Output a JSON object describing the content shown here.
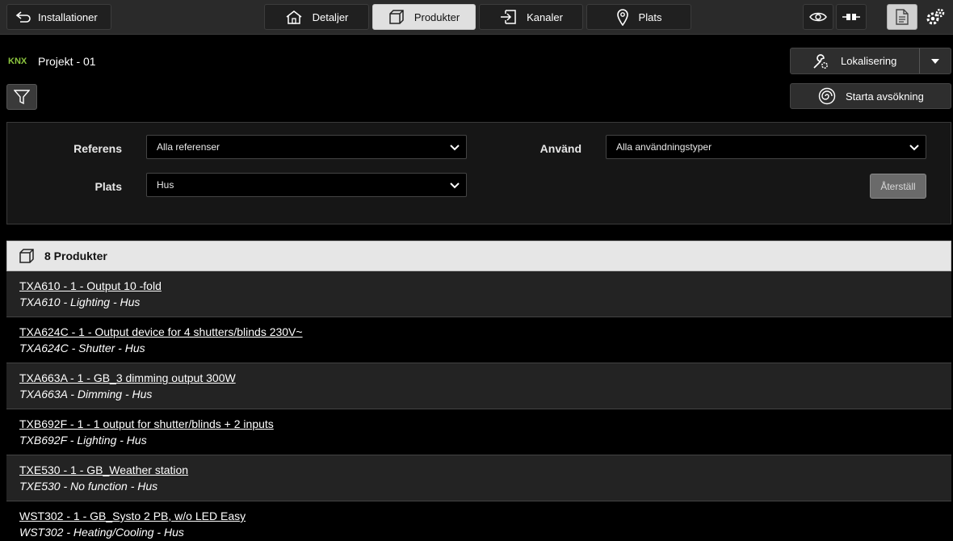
{
  "toolbar": {
    "back_label": "Installationer",
    "tabs": [
      {
        "label": "Detaljer",
        "icon": "home-icon"
      },
      {
        "label": "Produkter",
        "icon": "cube-icon"
      },
      {
        "label": "Kanaler",
        "icon": "channel-icon"
      },
      {
        "label": "Plats",
        "icon": "location-pin-icon"
      }
    ],
    "active_tab": "Produkter",
    "right_icons": [
      "eye-icon",
      "connector-icon",
      "document-icon",
      "gears-icon"
    ]
  },
  "header": {
    "logo_text": "KNX",
    "project_title": "Projekt - 01",
    "localization_label": "Lokalisering",
    "scan_label": "Starta avsökning"
  },
  "filters": {
    "reference_label": "Referens",
    "reference_value": "Alla referenser",
    "use_label": "Använd",
    "use_value": "Alla användningstyper",
    "location_label": "Plats",
    "location_value": "Hus",
    "reset_label": "Återställ"
  },
  "products": {
    "header": "8 Produkter",
    "items": [
      {
        "title": "TXA610 - 1 - Output 10 -fold",
        "subtitle": "TXA610 - Lighting - Hus"
      },
      {
        "title": "TXA624C - 1 - Output device for 4 shutters/blinds 230V~",
        "subtitle": "TXA624C - Shutter - Hus"
      },
      {
        "title": "TXA663A - 1 - GB_3 dimming output 300W",
        "subtitle": "TXA663A - Dimming - Hus"
      },
      {
        "title": "TXB692F - 1 - 1 output for shutter/blinds + 2 inputs",
        "subtitle": "TXB692F - Lighting - Hus"
      },
      {
        "title": "TXE530 - 1 - GB_Weather station",
        "subtitle": "TXE530 - No function - Hus"
      },
      {
        "title": "WST302 - 1 - GB_Systo 2 PB, w/o LED Easy",
        "subtitle": "WST302 - Heating/Cooling - Hus"
      }
    ]
  },
  "colors": {
    "background": "#000000",
    "toolbar": "#2a2a2a",
    "active_tab": "#e0e0e0",
    "knx_green": "#8dc63f",
    "row_alt": "#232323"
  }
}
